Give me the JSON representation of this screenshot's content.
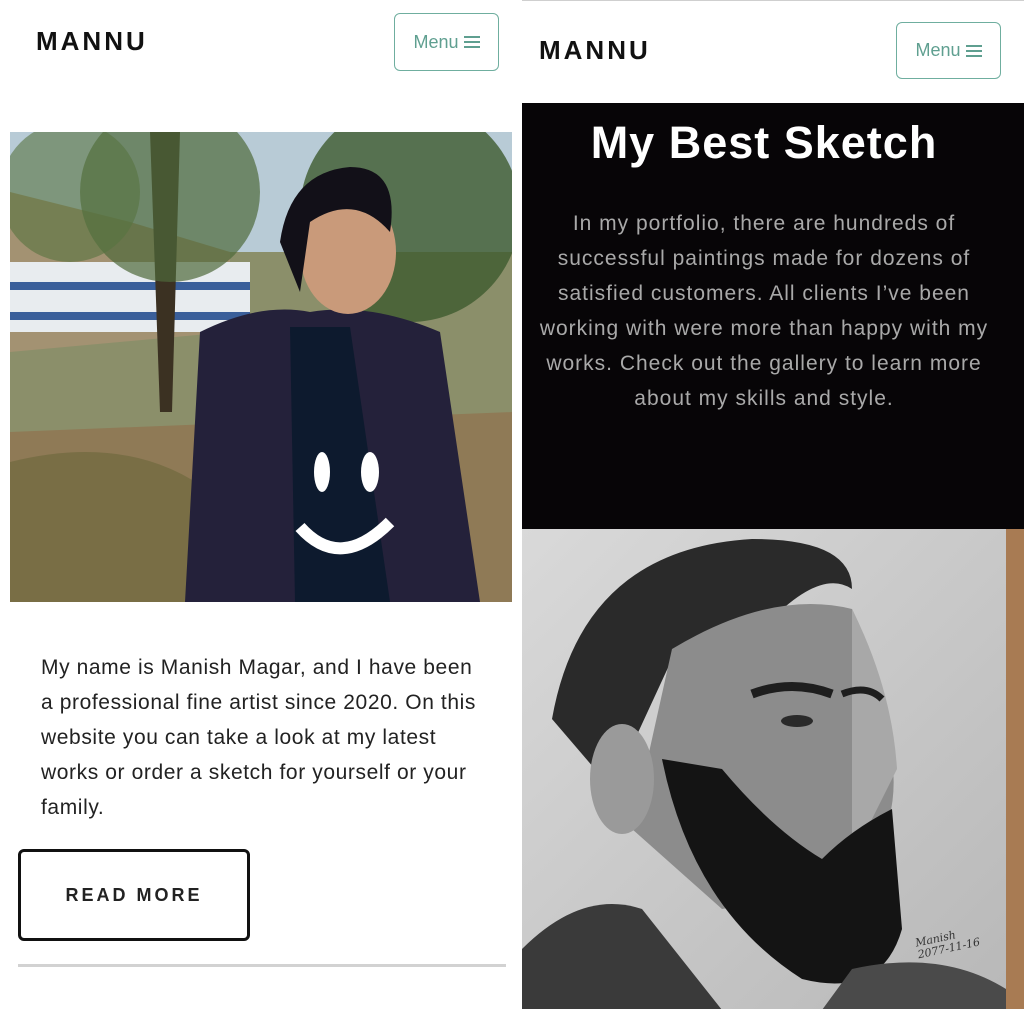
{
  "left_screen": {
    "brand": "MANNU",
    "menu_label": "Menu",
    "intro_text": "My name is Manish Magar, and I have been a professional fine artist since 2020. On this website you can take a look at my latest works or order a sketch for yourself or your family.",
    "read_more_label": "READ MORE"
  },
  "right_screen": {
    "brand": "MANNU",
    "menu_label": "Menu",
    "section_title": "My Best Sketch",
    "section_text": "In my portfolio, there are hundreds of successful paintings made for dozens of satisfied customers. All clients I’ve been working with were more than happy with my works. Check out the gallery to learn more about my skills and style.",
    "sketch_signature_name": "Manish",
    "sketch_signature_date": "2077-11-16"
  },
  "icons": {
    "menu": "hamburger-icon"
  },
  "colors": {
    "accent": "#5f9f90",
    "dark_section_bg": "#070507",
    "body_text": "#222222",
    "muted_text": "#a9a9a9"
  }
}
